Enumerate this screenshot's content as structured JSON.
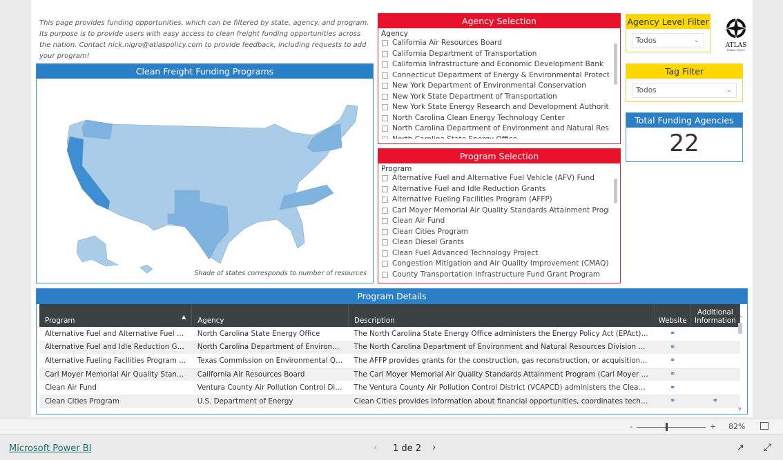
{
  "intro": "This page provides funding opportunities, which can be filtered by state, agency, and program. Its purpose is to provide users with easy access to clean freight funding opportunities across the nation. Contact nick.nigro@atlaspolicy.com to provide feedback, including requests to add your program!",
  "map": {
    "title": "Clean Freight Funding Programs",
    "caption": "Shade of states corresponds to number of resources",
    "colors": {
      "base": "#a9cce8",
      "mid": "#7fb3df",
      "high": "#3d8fd1"
    }
  },
  "agency": {
    "title": "Agency Selection",
    "label": "Agency",
    "items": [
      "California Air Resources Board",
      "California Department of Transportation",
      "California Infrastructure and Economic Development Bank",
      "Connecticut Department of Energy & Environmental Protection",
      "New York Department of Environmental Conservation",
      "New York State Department of Transportation",
      "New York State Energy Research and Development Authority (NYS...",
      "North Carolina Clean Energy Technology Center",
      "North Carolina Department of Environment and Natural Resources ...",
      "North Carolina State Energy Office"
    ]
  },
  "program": {
    "title": "Program Selection",
    "label": "Program",
    "items": [
      "Alternative Fuel and Alternative Fuel Vehicle (AFV) Fund",
      "Alternative Fuel and Idle Reduction Grants",
      "Alternative Fueling Facilities Program (AFFP)",
      "Carl Moyer Memorial Air Quality Standards Attainment Program (C...",
      "Clean Air Fund",
      "Clean Cities Program",
      "Clean Diesel Grants",
      "Clean Fuel Advanced Technology Project",
      "Congestion Mitigation and Air Quality Improvement (CMAQ) Progr...",
      "County Transportation Infrastructure Fund Grant Program"
    ]
  },
  "agency_level": {
    "title": "Agency Level Filter",
    "value": "Todos"
  },
  "tag": {
    "title": "Tag Filter",
    "value": "Todos"
  },
  "logo": {
    "text": "ATLAS",
    "sub": "PUBLIC POLICY"
  },
  "kpi": {
    "title": "Total Funding Agencies",
    "value": "22"
  },
  "details": {
    "title": "Program Details",
    "columns": [
      "Program",
      "Agency",
      "Description",
      "Website",
      "Additional Information"
    ],
    "rows": [
      [
        "Alternative Fuel and Alternative Fuel Vehi...",
        "North Carolina State Energy Office",
        "The North Carolina State Energy Office administers the Energy Policy Act (EPAct) Credit ...",
        true,
        false
      ],
      [
        "Alternative Fuel and Idle Reduction Grants",
        "North Carolina Department of Environmen...",
        "The North Carolina Department of Environment and Natural Resources Division of Air Q...",
        true,
        false
      ],
      [
        "Alternative Fueling Facilities Program (AF...",
        "Texas Commission on Environmental Quality",
        "The AFFP provides grants for the construction, gas reconstruction, or acquisition of facili...",
        true,
        false
      ],
      [
        "Carl Moyer Memorial Air Quality Standar...",
        "California Air Resources Board",
        "The Carl Moyer Memorial Air Quality Standards Attainment Program (Carl Moyer Progra...",
        true,
        false
      ],
      [
        "Clean Air Fund",
        "Ventura County Air Pollution Control District",
        "The Ventura County Air Pollution Control District (VCAPCD) administers the Clean Air Fu...",
        true,
        false
      ],
      [
        "Clean Cities Program",
        "U.S. Department of Energy",
        "Clean Cities provides information about financial opportunities, coordinates technical as...",
        true,
        true
      ]
    ]
  },
  "zoom": {
    "minus": "-",
    "plus": "+",
    "level": "82%",
    "value": 0.82
  },
  "footer": {
    "brand": "Microsoft Power BI",
    "page": "1 de 2"
  }
}
